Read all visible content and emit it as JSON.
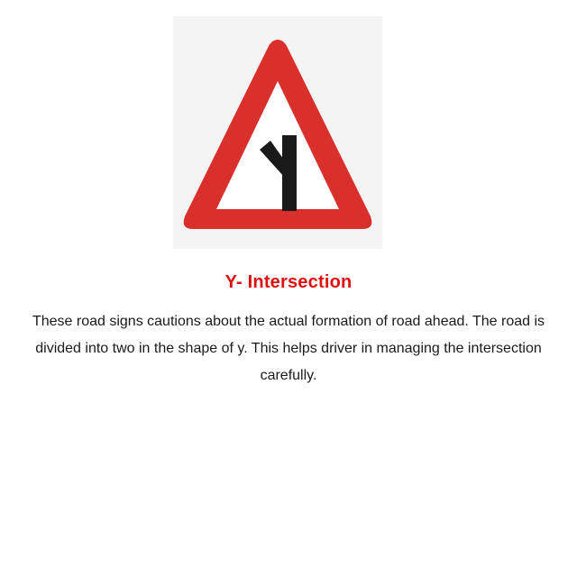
{
  "sign": {
    "icon": "y-intersection-warning-sign-icon",
    "border_color": "#d9302c",
    "fill_color": "#ffffff",
    "symbol_color": "#1a1a1a"
  },
  "title": "Y- Intersection",
  "description": "These road signs cautions about the actual formation of road ahead. The road is divided into two in the shape of y. This helps driver in managing the intersection carefully."
}
